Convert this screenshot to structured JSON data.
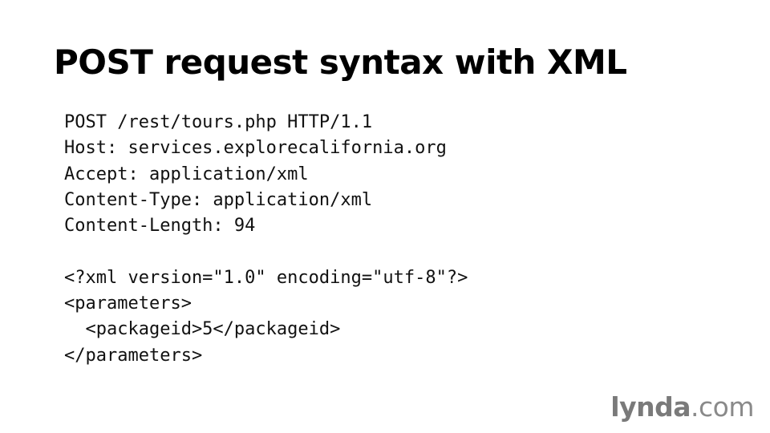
{
  "slide": {
    "title": "POST request syntax with XML",
    "code_lines": [
      "POST /rest/tours.php HTTP/1.1",
      "Host: services.explorecalifornia.org",
      "Accept: application/xml",
      "Content-Type: application/xml",
      "Content-Length: 94",
      "",
      "<?xml version=\"1.0\" encoding=\"utf-8\"?>",
      "<parameters>",
      "  <packageid>5</packageid>",
      "</parameters>"
    ]
  },
  "logo": {
    "brand": "lynda",
    "tld": ".com"
  }
}
